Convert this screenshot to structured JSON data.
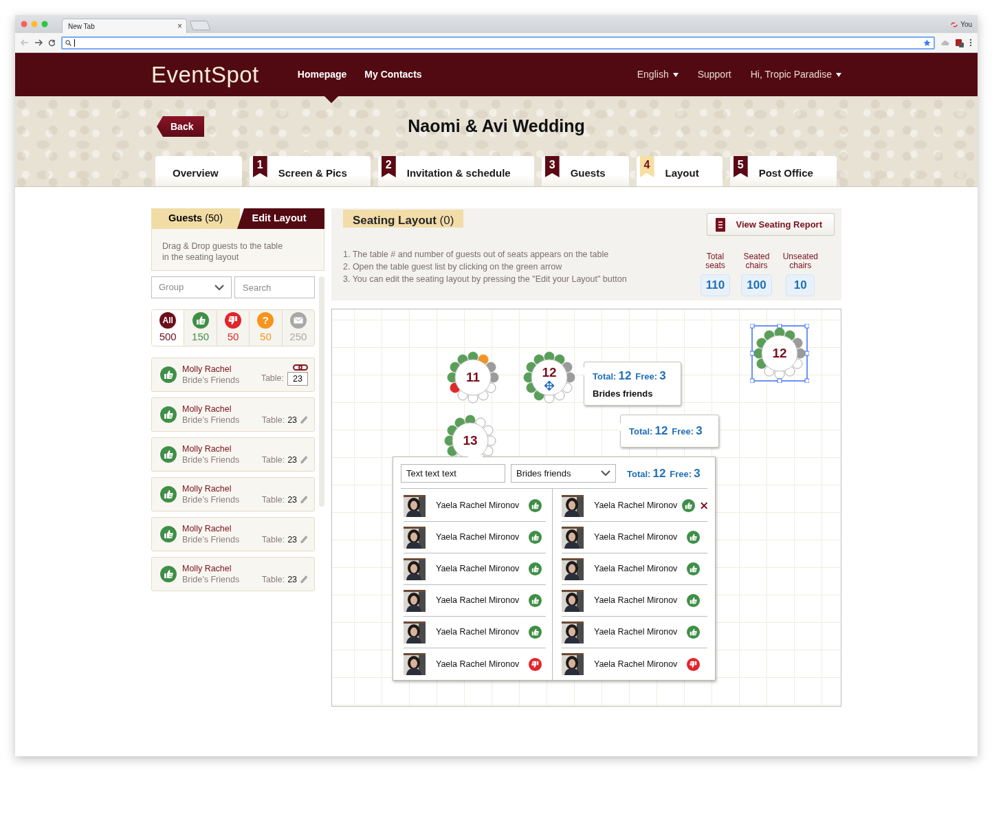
{
  "browser": {
    "tab_title": "New Tab",
    "tab_close": "×",
    "profile": "You"
  },
  "header": {
    "logo": "EventSpot",
    "nav": [
      {
        "label": "Homepage",
        "selected": true
      },
      {
        "label": "My Contacts",
        "selected": false
      }
    ],
    "language": "English",
    "support": "Support",
    "user": "Hi, Tropic Paradise"
  },
  "banner": {
    "back": "Back",
    "title": "Naomi & Avi Wedding",
    "tabs": [
      {
        "label": "Overview",
        "selected": false
      },
      {
        "number": "1",
        "label": "Screen & Pics",
        "selected": false
      },
      {
        "number": "2",
        "label": "Invitation & schedule",
        "selected": false
      },
      {
        "number": "3",
        "label": "Guests",
        "selected": false
      },
      {
        "number": "4",
        "label": "Layout",
        "selected": true
      },
      {
        "number": "5",
        "label": "Post Office",
        "selected": false
      }
    ]
  },
  "guest_panel": {
    "tabs": [
      {
        "label": "**Guests** (50)",
        "selected": true
      },
      {
        "label": "Edit Layout",
        "selected": false
      }
    ],
    "hint": "Drag & Drop guests to the table\nin the seating layout",
    "group_select": "Group",
    "search_placeholder": "Search",
    "filters": [
      {
        "kind": "all",
        "icon_label": "All",
        "count": "500",
        "selected": true
      },
      {
        "kind": "yes",
        "count": "150",
        "selected": false
      },
      {
        "kind": "no",
        "count": "50",
        "selected": false
      },
      {
        "kind": "maybe",
        "icon_label": "?",
        "count": "50",
        "selected": false
      },
      {
        "kind": "pending",
        "count": "250",
        "selected": false
      }
    ],
    "guests": [
      {
        "name": "Molly Rachel",
        "group": "Bride’s Friends",
        "table_label": "Table:",
        "table": "23",
        "kind": "yes",
        "editing": true
      },
      {
        "name": "Molly Rachel",
        "group": "Bride’s Friends",
        "table_label": "Table:",
        "table": "23",
        "kind": "yes",
        "editing": false
      },
      {
        "name": "Molly Rachel",
        "group": "Bride’s Friends",
        "table_label": "Table:",
        "table": "23",
        "kind": "yes",
        "editing": false
      },
      {
        "name": "Molly Rachel",
        "group": "Bride’s Friends",
        "table_label": "Table:",
        "table": "23",
        "kind": "yes",
        "editing": false
      },
      {
        "name": "Molly Rachel",
        "group": "Bride’s Friends",
        "table_label": "Table:",
        "table": "23",
        "kind": "yes",
        "editing": false
      },
      {
        "name": "Molly Rachel",
        "group": "Bride’s Friends",
        "table_label": "Table:",
        "table": "23",
        "kind": "yes",
        "editing": false
      }
    ]
  },
  "seating": {
    "title": "**Seating Layout** (0)",
    "report_button": "View Seating Report",
    "instructions": [
      "1. The table # and number of guests out of seats appears on the table",
      "2. Open the table guest list by clicking on the green arrow",
      "3. You can edit the seating layout by pressing the \"Edit your Layout\" button"
    ],
    "stats": [
      {
        "label": "Total\nseats",
        "value": "110"
      },
      {
        "label": "Seated\nchairs",
        "value": "100"
      },
      {
        "label": "Unseated\nchairs",
        "value": "10"
      }
    ]
  },
  "canvas": {
    "tables": [
      {
        "number": "11",
        "selected": false,
        "move_handle": false,
        "seats": [
          {
            "kind": "yes"
          },
          {
            "kind": "maybe"
          },
          {
            "kind": "pending"
          },
          {
            "kind": "pending"
          },
          {
            "kind": "empty"
          },
          {
            "kind": "empty"
          },
          {
            "kind": "empty"
          },
          {
            "kind": "empty"
          },
          {
            "kind": "no"
          },
          {
            "kind": "yes"
          },
          {
            "kind": "yes"
          },
          {
            "kind": "yes"
          }
        ]
      },
      {
        "number": "12",
        "selected": false,
        "move_handle": true,
        "seats": [
          {
            "kind": "yes"
          },
          {
            "kind": "yes"
          },
          {
            "kind": "pending"
          },
          {
            "kind": "pending"
          },
          {
            "kind": "empty"
          },
          {
            "kind": "empty"
          },
          {
            "kind": "empty"
          },
          {
            "kind": "yes"
          },
          {
            "kind": "yes"
          },
          {
            "kind": "yes"
          },
          {
            "kind": "yes"
          },
          {
            "kind": "yes"
          }
        ]
      },
      {
        "number": "13",
        "selected": false,
        "move_handle": false,
        "seats": [
          {
            "kind": "yes"
          },
          {
            "kind": "empty"
          },
          {
            "kind": "empty"
          },
          {
            "kind": "empty"
          },
          {
            "kind": "empty"
          },
          {
            "kind": "empty"
          },
          {
            "kind": "empty"
          },
          {
            "kind": "empty"
          },
          {
            "kind": "yes"
          },
          {
            "kind": "yes"
          },
          {
            "kind": "yes"
          },
          {
            "kind": "yes"
          }
        ]
      },
      {
        "number": "12",
        "selected": true,
        "move_handle": false,
        "seats": [
          {
            "kind": "yes"
          },
          {
            "kind": "yes"
          },
          {
            "kind": "pending"
          },
          {
            "kind": "pending"
          },
          {
            "kind": "empty"
          },
          {
            "kind": "empty"
          },
          {
            "kind": "empty"
          },
          {
            "kind": "empty"
          },
          {
            "kind": "yes"
          },
          {
            "kind": "yes"
          },
          {
            "kind": "yes"
          },
          {
            "kind": "yes"
          }
        ]
      }
    ],
    "tooltips": [
      {
        "total_label": "Total:",
        "total": "12",
        "free_label": "Free:",
        "free": "3",
        "group": "Brides friends"
      },
      {
        "total_label": "Total:",
        "total": "12",
        "free_label": "Free:",
        "free": "3"
      }
    ],
    "popup": {
      "name_field": "Text text text",
      "group_select": "Brides friends",
      "total_label": "Total:",
      "total": "12",
      "free_label": "Free:",
      "free": "3",
      "columns": [
        [
          {
            "name": "Yaela Rachel Mironov",
            "kind": "yes",
            "removable": false
          },
          {
            "name": "Yaela Rachel Mironov",
            "kind": "yes",
            "removable": false
          },
          {
            "name": "Yaela Rachel Mironov",
            "kind": "yes",
            "removable": false
          },
          {
            "name": "Yaela Rachel Mironov",
            "kind": "yes",
            "removable": false
          },
          {
            "name": "Yaela Rachel Mironov",
            "kind": "yes",
            "removable": false
          },
          {
            "name": "Yaela Rachel Mironov",
            "kind": "no",
            "removable": false
          }
        ],
        [
          {
            "name": "Yaela Rachel Mironov",
            "kind": "yes",
            "removable": true
          },
          {
            "name": "Yaela Rachel Mironov",
            "kind": "yes",
            "removable": false
          },
          {
            "name": "Yaela Rachel Mironov",
            "kind": "yes",
            "removable": false
          },
          {
            "name": "Yaela Rachel Mironov",
            "kind": "yes",
            "removable": false
          },
          {
            "name": "Yaela Rachel Mironov",
            "kind": "yes",
            "removable": false
          },
          {
            "name": "Yaela Rachel Mironov",
            "kind": "no",
            "removable": false
          }
        ]
      ]
    }
  }
}
